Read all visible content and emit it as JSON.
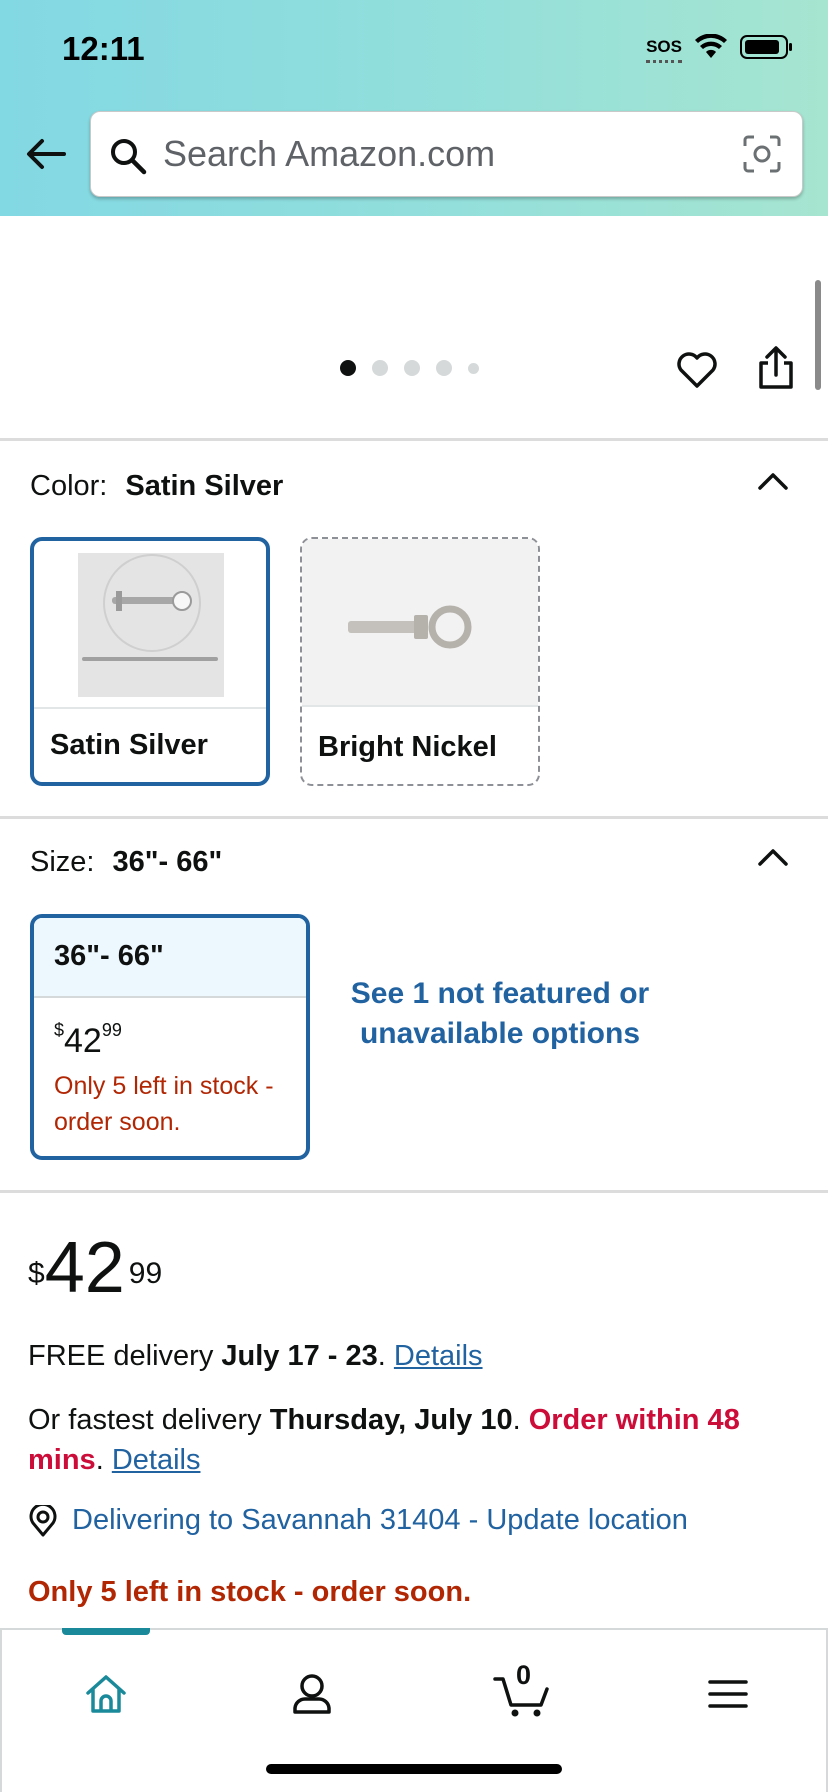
{
  "status_bar": {
    "time": "12:11",
    "sos": "SOS"
  },
  "search": {
    "placeholder": "Search Amazon.com"
  },
  "carousel": {
    "image_count": 5,
    "active_index": 0
  },
  "color": {
    "label": "Color:",
    "selected": "Satin Silver",
    "options": [
      {
        "name": "Satin Silver",
        "selected": true
      },
      {
        "name": "Bright Nickel",
        "selected": false
      }
    ]
  },
  "size": {
    "label": "Size:",
    "selected": "36\"- 66\"",
    "option": {
      "name": "36\"- 66\"",
      "price_dollars": "42",
      "price_cents": "99",
      "price_symbol": "$",
      "stock": "Only 5 left in stock - order soon."
    },
    "see_more": "See 1 not featured or unavailable options"
  },
  "price": {
    "symbol": "$",
    "dollars": "42",
    "cents": "99"
  },
  "delivery": {
    "free_prefix": "FREE delivery ",
    "free_dates": "July 17 - 23",
    "free_suffix": ". ",
    "details_1": "Details",
    "fast_prefix": "Or fastest delivery ",
    "fast_date": "Thursday, July 10",
    "fast_mid": ". ",
    "order_within": "Order within 48 mins",
    "fast_suffix": ". ",
    "details_2": "Details",
    "location": "Delivering to Savannah 31404 - Update location",
    "stock": "Only 5 left in stock - order soon."
  },
  "nav": {
    "cart_count": "0"
  },
  "colors": {
    "accent": "#2162a1",
    "stock_red": "#b12704",
    "urgent_red": "#cc0c39",
    "nav_teal": "#1a8a9a"
  }
}
